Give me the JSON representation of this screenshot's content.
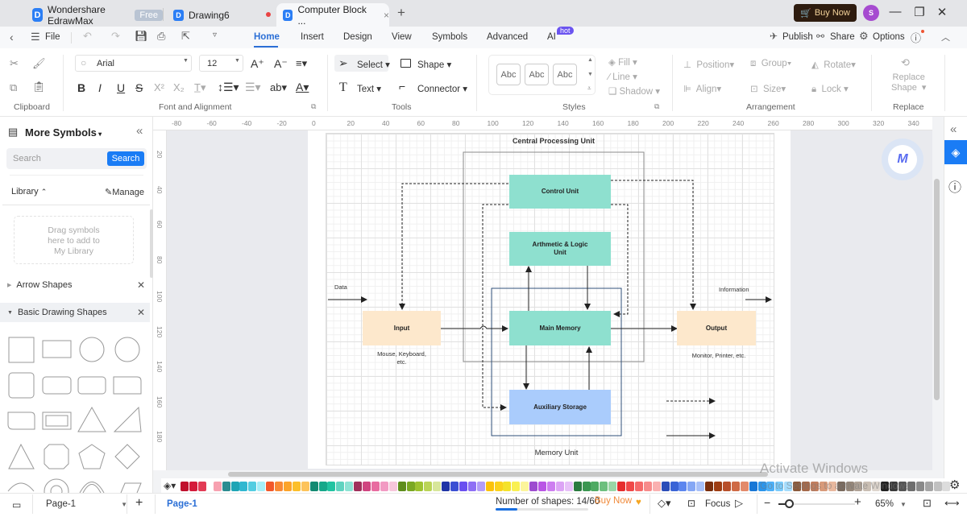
{
  "titlebar": {
    "app_name": "Wondershare EdrawMax",
    "free_badge": "Free",
    "tabs": [
      {
        "label": "Drawing6",
        "unsaved": true
      },
      {
        "label": "Computer Block ...",
        "active": true
      }
    ],
    "new_tab": "+",
    "buy_now": "Buy Now",
    "avatar_initial": "S",
    "logo_glyph": "D"
  },
  "menubar": {
    "file": "File",
    "tabs": [
      "Home",
      "Insert",
      "Design",
      "View",
      "Symbols",
      "Advanced",
      "AI"
    ],
    "ai_badge": "hot",
    "active_tab": "Home",
    "publish": "Publish",
    "share": "Share",
    "options": "Options"
  },
  "ribbon": {
    "clipboard": {
      "label": "Clipboard"
    },
    "font": {
      "family": "Arial",
      "size": "12",
      "label": "Font and Alignment",
      "bold": "B",
      "italic": "I",
      "underline": "U",
      "strike": "S",
      "superscript": "X²",
      "subscript": "X₂",
      "text_style": "ab"
    },
    "tools": {
      "select": "Select",
      "shape": "Shape",
      "text": "Text",
      "connector": "Connector",
      "label": "Tools"
    },
    "styles": {
      "swatches": [
        "Abc",
        "Abc",
        "Abc"
      ],
      "fill": "Fill",
      "line": "Line",
      "shadow": "Shadow",
      "label": "Styles"
    },
    "arrangement": {
      "position": "Position",
      "group": "Group",
      "rotate": "Rotate",
      "align": "Align",
      "size": "Size",
      "lock": "Lock",
      "label": "Arrangement"
    },
    "replace": {
      "line1": "Replace",
      "line2": "Shape",
      "label": "Replace"
    }
  },
  "left_panel": {
    "title": "More Symbols",
    "search_placeholder": "Search",
    "search_button": "Search",
    "library": "Library",
    "manage": "Manage",
    "drop_hint_lines": [
      "Drag symbols",
      "here to add to",
      "My Library"
    ],
    "categories": [
      {
        "label": "Arrow Shapes",
        "expanded": false
      },
      {
        "label": "Basic Drawing Shapes",
        "expanded": true
      }
    ]
  },
  "rulers": {
    "horizontal": [
      "-80",
      "-60",
      "-40",
      "-20",
      "0",
      "20",
      "40",
      "60",
      "80",
      "100",
      "120",
      "140",
      "160",
      "180",
      "200",
      "220",
      "240",
      "260",
      "280",
      "300",
      "320",
      "340"
    ],
    "vertical": [
      "20",
      "40",
      "60",
      "80",
      "100",
      "120",
      "140",
      "160",
      "180"
    ]
  },
  "diagram": {
    "cpu_title": "Central Processing Unit",
    "memory_title": "Memory Unit",
    "nodes": {
      "control_unit": "Control Unit",
      "alu_line1": "Arthmetic & Logic",
      "alu_line2": "Unit",
      "main_memory": "Main Memory",
      "aux_storage": "Auxiliary Storage",
      "input": "Input",
      "output": "Output"
    },
    "captions": {
      "input_line1": "Mouse, Keyboard,",
      "input_line2": "etc.",
      "output": "Monitor, Printer, etc.",
      "data": "Data",
      "information": "Information"
    },
    "colors": {
      "teal": "#8ee0cf",
      "peach": "#fde8cc",
      "blue": "#aaccfc",
      "cpu_border": "#8a8a8a",
      "memory_border": "#2f4f7a"
    }
  },
  "palette": [
    "#c0102d",
    "#d41a3a",
    "#e23b55",
    "#f7a1b0",
    "#2b8c91",
    "#1ea5b5",
    "#30b7d0",
    "#53cde1",
    "#a6eef7",
    "#f2582a",
    "#f88a35",
    "#fca42a",
    "#fcbf2a",
    "#fdc35a",
    "#138a72",
    "#16a88a",
    "#21c3a1",
    "#5fd3bf",
    "#8de3d4",
    "#a0305b",
    "#d04580",
    "#e86ba0",
    "#f29ac3",
    "#f6c6db",
    "#5e8d1c",
    "#7aa822",
    "#9dc22f",
    "#bad456",
    "#d7e69a",
    "#1f34a6",
    "#3b4fd3",
    "#6a4ff0",
    "#8e6ff5",
    "#b39df8",
    "#fcc20a",
    "#fbd21c",
    "#f4e22a",
    "#f9f052",
    "#fcf59b",
    "#9d4ccf",
    "#b955e5",
    "#cd7ef0",
    "#dca4f5",
    "#e7c1f8",
    "#2a7a3f",
    "#3a9650",
    "#4eaa62",
    "#6dbf7e",
    "#9ad6a6",
    "#e62d2d",
    "#f04848",
    "#f56a6a",
    "#f78b8b",
    "#fab0b0",
    "#2b4cb8",
    "#3a64d6",
    "#5c86ef",
    "#85a7f5",
    "#a8c0f8",
    "#7a2e0c",
    "#9e3d12",
    "#b84f2a",
    "#cf6a45",
    "#e38a6a",
    "#1877d6",
    "#2b95ec",
    "#4eb0f7",
    "#7acbfb",
    "#a5dcfc",
    "#8b5a3c",
    "#a5694a",
    "#c27e5e",
    "#d89a7a",
    "#e8b89e",
    "#7a6a5e",
    "#958679",
    "#afa296",
    "#c9beb3",
    "#ddd5cd",
    "#222222",
    "#3a3a3a",
    "#555555",
    "#6e6e6e",
    "#8a8a8a",
    "#a5a5a5",
    "#c0c0c0",
    "#dcdcdc"
  ],
  "statusbar": {
    "page_dropdown": "Page-1",
    "page_tab": "Page-1",
    "shape_count_label": "Number of shapes: 14/60",
    "shape_count_fraction": 0.233,
    "buy_now": "Buy Now",
    "focus": "Focus",
    "zoom": "65%",
    "zoom_slider_fraction": 0.1
  },
  "watermark": {
    "line1": "Activate Windows",
    "line2": "Go to Settings to activate Windows."
  }
}
